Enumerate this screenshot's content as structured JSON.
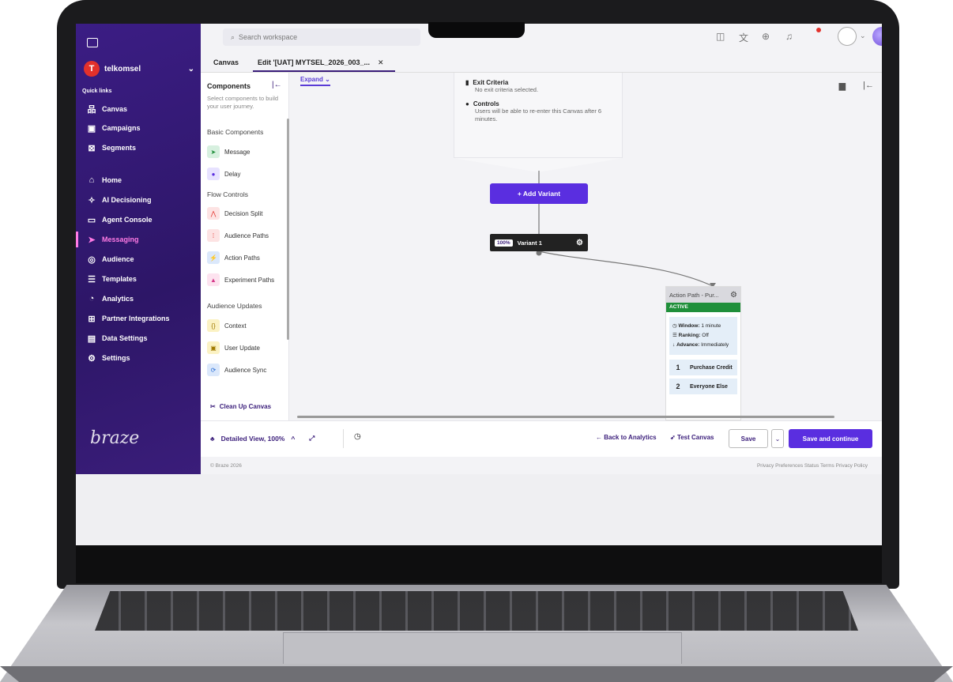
{
  "sidebar": {
    "brand": "telkomsel",
    "quick_links_label": "Quick links",
    "quick_links": [
      {
        "label": "Canvas",
        "icon": "canvas-icon"
      },
      {
        "label": "Campaigns",
        "icon": "campaigns-icon"
      },
      {
        "label": "Segments",
        "icon": "segments-icon"
      }
    ],
    "nav": [
      {
        "label": "Home",
        "icon": "home-icon"
      },
      {
        "label": "AI Decisioning",
        "icon": "sparkle-icon"
      },
      {
        "label": "Agent Console",
        "icon": "console-icon"
      },
      {
        "label": "Messaging",
        "icon": "messaging-icon",
        "active": true
      },
      {
        "label": "Audience",
        "icon": "audience-icon"
      },
      {
        "label": "Templates",
        "icon": "templates-icon"
      },
      {
        "label": "Analytics",
        "icon": "analytics-icon"
      },
      {
        "label": "Partner Integrations",
        "icon": "integrations-icon"
      },
      {
        "label": "Data Settings",
        "icon": "data-icon"
      },
      {
        "label": "Settings",
        "icon": "gear-icon"
      }
    ],
    "logo_text": "braze"
  },
  "topbar": {
    "search_placeholder": "Search workspace"
  },
  "tabs": [
    {
      "label": "Canvas"
    },
    {
      "label": "Edit '[UAT] MYTSEL_2026_003_...",
      "active": true
    }
  ],
  "components": {
    "title": "Components",
    "subtitle": "Select components to build your user journey.",
    "sections": [
      {
        "title": "Basic Components",
        "items": [
          {
            "label": "Message",
            "chip_color": "#d7f0df",
            "glyph": "➤"
          },
          {
            "label": "Delay",
            "chip_color": "#e7e2ff",
            "glyph": "●"
          }
        ]
      },
      {
        "title": "Flow Controls",
        "items": [
          {
            "label": "Decision Split",
            "chip_color": "#fde3e3",
            "glyph": "⋀"
          },
          {
            "label": "Audience Paths",
            "chip_color": "#fde3e3",
            "glyph": "⁞"
          },
          {
            "label": "Action Paths",
            "chip_color": "#dbe8fb",
            "glyph": "⚡"
          },
          {
            "label": "Experiment Paths",
            "chip_color": "#fde3ef",
            "glyph": "▲"
          }
        ]
      },
      {
        "title": "Audience Updates",
        "items": [
          {
            "label": "Context",
            "chip_color": "#fbf2c4",
            "glyph": "{}"
          },
          {
            "label": "User Update",
            "chip_color": "#fbf2c4",
            "glyph": "▣"
          },
          {
            "label": "Audience Sync",
            "chip_color": "#dbe8fb",
            "glyph": "⟳"
          }
        ]
      }
    ],
    "cleanup_label": "Clean Up Canvas"
  },
  "canvas": {
    "expand_label": "Expand",
    "exit_title": "Exit Criteria",
    "exit_text": "No exit criteria selected.",
    "controls_title": "Controls",
    "controls_text": "Users will be able to re-enter this Canvas after 6 minutes.",
    "add_variant_label": "+ Add Variant",
    "variant_pct": "100%",
    "variant_label": "Variant 1",
    "action_path": {
      "title": "Action Path - Pur...",
      "status": "ACTIVE",
      "window_label": "Window:",
      "window_value": "1 minute",
      "ranking_label": "Ranking:",
      "ranking_value": "Off",
      "advance_label": "Advance:",
      "advance_value": "Immediately",
      "paths": [
        {
          "num": "1",
          "label": "Purchase Credit"
        },
        {
          "num": "2",
          "label": "Everyone Else"
        }
      ]
    }
  },
  "bottombar": {
    "view_label": "Detailed View, 100%",
    "back_label": "← Back to Analytics",
    "test_label": "Test Canvas",
    "save_label": "Save",
    "continue_label": "Save and continue"
  },
  "footer": {
    "copyright": "© Braze 2026",
    "links": "Privacy Preferences  Status  Terms  Privacy Policy"
  },
  "colors": {
    "brand_purple": "#3a1d7a",
    "accent": "#5a2ee0",
    "active_green": "#1f8f3a",
    "active_nav": "#ff7be5"
  }
}
